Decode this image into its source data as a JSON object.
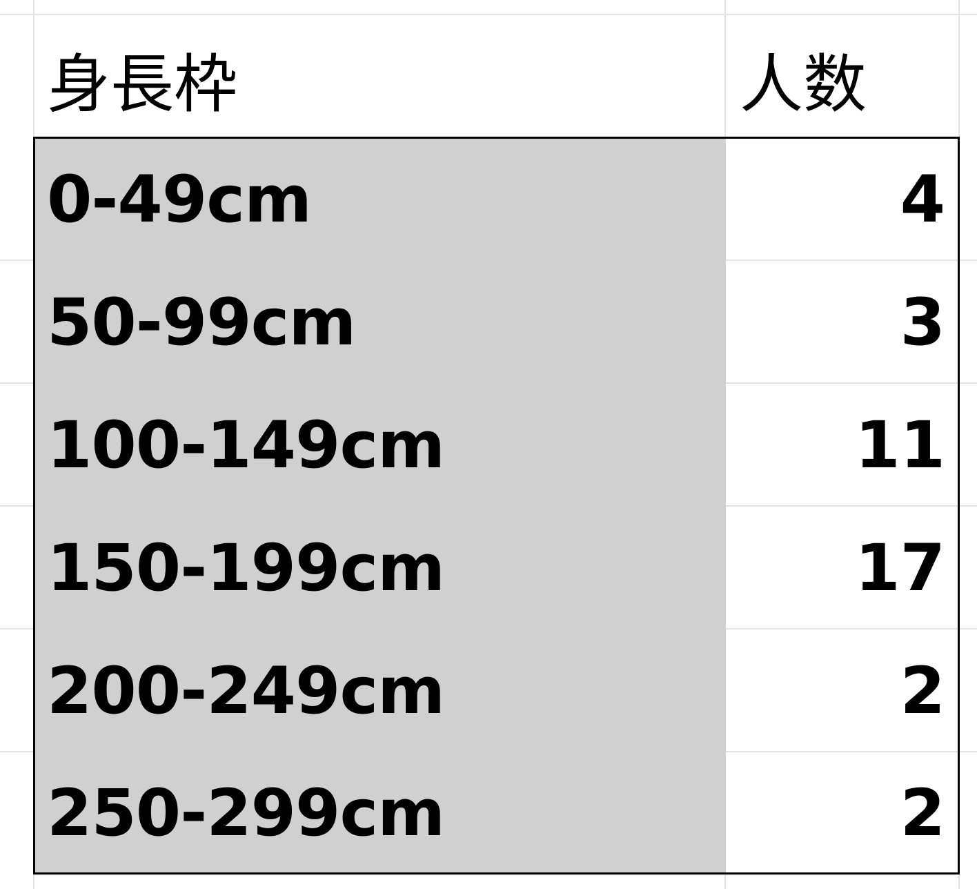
{
  "table": {
    "headers": {
      "label": "身長枠",
      "count": "人数"
    },
    "rows": [
      {
        "label": "0-49cm",
        "count": "4"
      },
      {
        "label": "50-99cm",
        "count": "3"
      },
      {
        "label": "100-149cm",
        "count": "11"
      },
      {
        "label": "150-199cm",
        "count": "17"
      },
      {
        "label": "200-249cm",
        "count": "2"
      },
      {
        "label": "250-299cm",
        "count": "2"
      }
    ]
  },
  "colors": {
    "label_fill": "#d0d0d0",
    "gridline": "#e3e3e3",
    "border": "#000000"
  }
}
